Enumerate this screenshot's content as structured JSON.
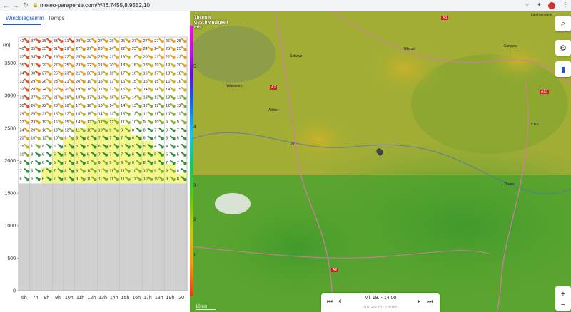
{
  "browser": {
    "url": "meteo-parapente.com/#/46.7455,8.9552,10"
  },
  "tabs": [
    {
      "label": "Winddiagramm",
      "active": true
    },
    {
      "label": "Temps",
      "active": false
    }
  ],
  "chart_data": {
    "type": "heatmap",
    "ylabel": "(m)",
    "y_ticks": [
      0,
      500,
      1000,
      1500,
      2000,
      2500,
      3000,
      3500
    ],
    "ylim": [
      0,
      3900
    ],
    "hours": [
      "6h",
      "7h",
      "8h",
      "9h",
      "10h",
      "11h",
      "12h",
      "13h",
      "14h",
      "15h",
      "16h",
      "17h",
      "18h",
      "19h",
      "20"
    ],
    "ground_level_m": 1650,
    "thermal_ceiling_m": [
      1650,
      1650,
      1900,
      2150,
      2350,
      2500,
      2600,
      2650,
      2650,
      2550,
      2400,
      2300,
      2150,
      1950,
      1800
    ],
    "rows_altitude_m": [
      3850,
      3725,
      3600,
      3475,
      3350,
      3225,
      3100,
      2975,
      2850,
      2725,
      2600,
      2475,
      2350,
      2225,
      2100,
      1975,
      1850,
      1725
    ],
    "speed_kmh": [
      [
        42,
        37,
        35,
        33,
        31,
        29,
        29,
        27,
        26,
        25,
        27,
        27,
        27,
        26,
        25
      ],
      [
        40,
        35,
        33,
        31,
        29,
        27,
        27,
        26,
        24,
        22,
        23,
        24,
        24,
        25,
        25
      ],
      [
        37,
        33,
        31,
        29,
        27,
        25,
        24,
        23,
        21,
        19,
        19,
        20,
        21,
        22,
        22
      ],
      [
        35,
        31,
        29,
        27,
        25,
        23,
        22,
        21,
        20,
        18,
        18,
        18,
        19,
        19,
        20
      ],
      [
        34,
        30,
        27,
        25,
        23,
        21,
        20,
        19,
        18,
        17,
        16,
        16,
        17,
        18,
        18
      ],
      [
        33,
        29,
        26,
        23,
        21,
        20,
        19,
        18,
        17,
        16,
        15,
        15,
        15,
        16,
        16
      ],
      [
        32,
        28,
        24,
        22,
        20,
        19,
        18,
        17,
        17,
        16,
        15,
        14,
        14,
        14,
        15
      ],
      [
        31,
        27,
        23,
        21,
        19,
        18,
        17,
        16,
        16,
        15,
        14,
        13,
        13,
        13,
        13
      ],
      [
        30,
        26,
        22,
        20,
        18,
        17,
        16,
        15,
        14,
        14,
        13,
        12,
        12,
        12,
        12
      ],
      [
        29,
        25,
        21,
        18,
        17,
        16,
        15,
        14,
        13,
        13,
        12,
        11,
        11,
        10,
        11
      ],
      [
        27,
        23,
        19,
        16,
        15,
        14,
        13,
        12,
        12,
        11,
        10,
        9,
        10,
        9,
        9
      ],
      [
        24,
        20,
        16,
        13,
        12,
        11,
        10,
        10,
        9,
        9,
        8,
        8,
        7,
        8,
        7
      ],
      [
        20,
        16,
        12,
        10,
        9,
        8,
        8,
        7,
        7,
        7,
        6,
        6,
        6,
        5,
        5
      ],
      [
        15,
        11,
        8,
        6,
        6,
        5,
        5,
        6,
        6,
        6,
        5,
        5,
        4,
        4,
        4
      ],
      [
        10,
        8,
        6,
        5,
        5,
        6,
        6,
        7,
        7,
        7,
        6,
        6,
        5,
        5,
        5
      ],
      [
        8,
        7,
        6,
        6,
        7,
        8,
        9,
        9,
        9,
        9,
        9,
        8,
        8,
        7,
        7
      ],
      [
        7,
        6,
        6,
        7,
        8,
        9,
        10,
        11,
        11,
        11,
        10,
        10,
        9,
        9,
        8
      ],
      [
        6,
        6,
        6,
        7,
        8,
        9,
        10,
        11,
        11,
        11,
        11,
        10,
        10,
        9,
        8
      ]
    ],
    "colors": {
      "strong": "#d9531e",
      "moderate": "#e89a1f",
      "medium": "#c7b21c",
      "light": "#7fae2b",
      "calm": "#2f8f3a",
      "thermal_fill": "#f4f88a",
      "ground": "#d0d0d0"
    }
  },
  "map": {
    "title_lines": [
      "Thermik",
      "Geschwindigkeit",
      "m/s"
    ],
    "colorbar_ticks": [
      "5",
      "4",
      "3",
      "2",
      "1"
    ],
    "scale_label": "10 km",
    "roads": [
      "A2",
      "A13",
      "A3",
      "A2"
    ],
    "places": [
      "Sargans",
      "Glarus",
      "Chur",
      "Thusis",
      "Schwyz",
      "Altdorf",
      "Nidwalden",
      "Uri",
      "Liechtenstein"
    ],
    "buttons": {
      "search": "⌕",
      "settings": "⚙",
      "chart": "▮",
      "zoom_in": "+",
      "zoom_out": "−"
    }
  },
  "timebar": {
    "label": "Mi. 18. - 14:00",
    "sub": "UTC+02:00 · 17h18Z"
  },
  "icons": {
    "back": "←",
    "forward": "→",
    "reload": "↻",
    "lock": "🔒",
    "star": "☆",
    "extensions": "✦",
    "menu": "⋮"
  }
}
